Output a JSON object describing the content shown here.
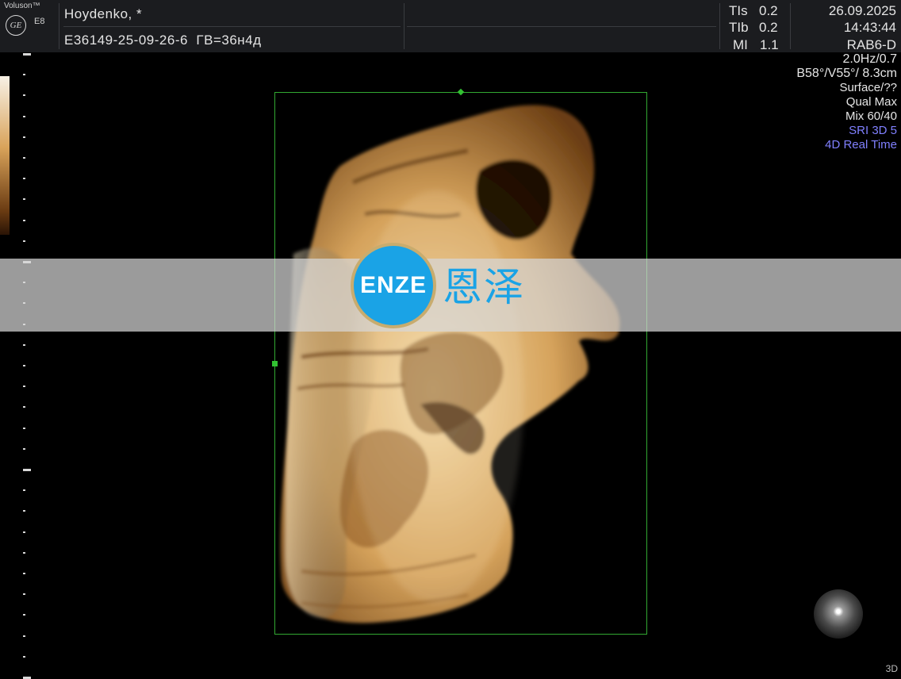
{
  "header": {
    "brand": "Voluson™",
    "logo": "GE",
    "model": "E8",
    "patient_name": "Hoydenko,   *",
    "exam_id": "E36149-25-09-26-6",
    "gestational_age": "ГВ=36н4д",
    "indices": [
      {
        "key": "TIs",
        "value": "0.2"
      },
      {
        "key": "TIb",
        "value": "0.2"
      },
      {
        "key": "MI",
        "value": "1.1"
      }
    ],
    "date": "26.09.2025",
    "time": "14:43:44",
    "probe": "RAB6-D"
  },
  "params": {
    "freq": "2.0Hz/0.7",
    "angle": "B58°/V55°/ 8.3cm",
    "render_mode": "Surface/??",
    "quality": "Qual Max",
    "mix": "Mix 60/40",
    "sri": "SRI 3D 5",
    "mode": "4D Real Time"
  },
  "watermark": {
    "logo_text": "ENZE",
    "cn_text": "恩泽"
  },
  "corner_label": "3D",
  "colors": {
    "roi_box": "#32a832",
    "tissue": "#e0b06a",
    "watermark_blue": "#1aa3e6",
    "param_blue": "#8080ff"
  },
  "icons": {
    "logo": "ge-logo-icon",
    "orientation": "render-orientation-sphere-icon"
  }
}
